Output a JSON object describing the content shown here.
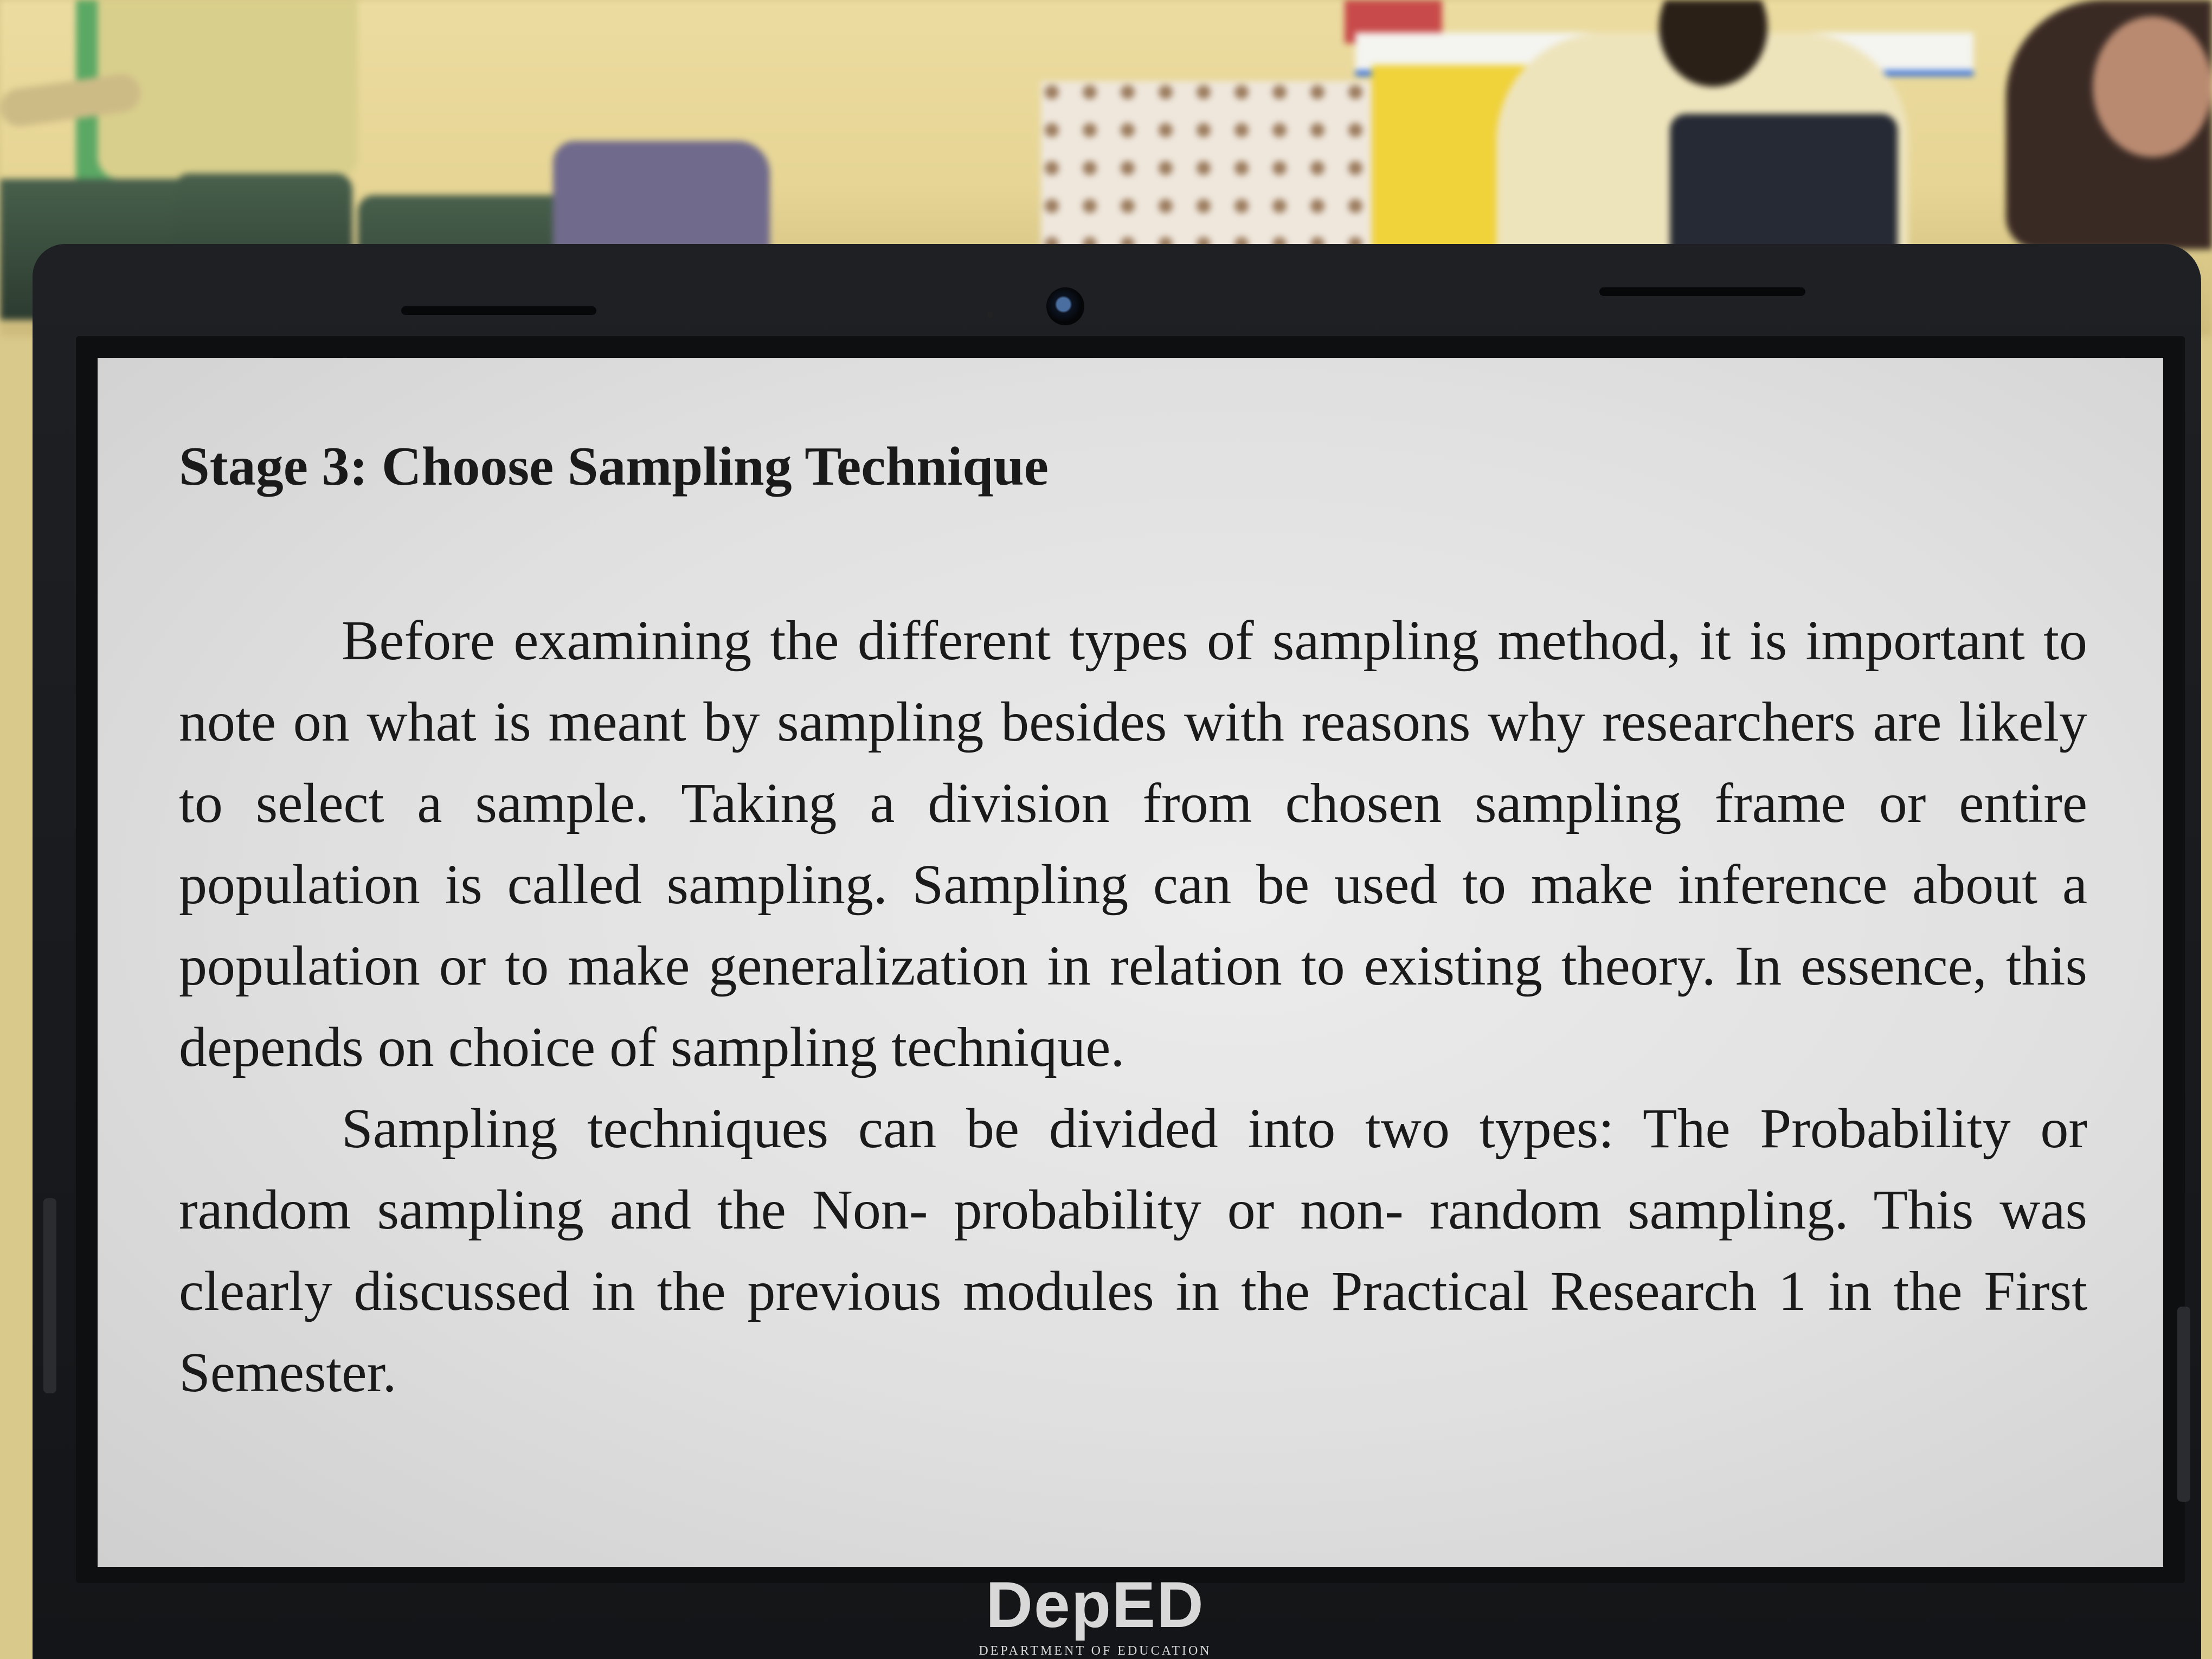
{
  "document": {
    "heading": "Stage 3: Choose Sampling Technique",
    "paragraphs": [
      "Before examining the different types of sampling method, it is important to note on what is meant by sampling besides with reasons why researchers are likely to select a sample. Taking a division from chosen sampling frame or entire population is called sampling. Sampling can be used to make inference about a population or to make generalization in relation to existing theory. In essence, this depends on choice of sampling technique.",
      "Sampling techniques can be divided into two types: The Probability or random sampling and the Non- probability or non- random sampling. This was clearly discussed in the previous modules in the Practical Research 1 in the First Semester."
    ]
  },
  "laptop": {
    "logo_text": "DepED",
    "logo_subtext": "DEPARTMENT OF EDUCATION"
  },
  "colors": {
    "bezel": "#141518",
    "screen": "#e0e0e0",
    "text": "#1a1a1a",
    "wall": "#e6d594"
  }
}
